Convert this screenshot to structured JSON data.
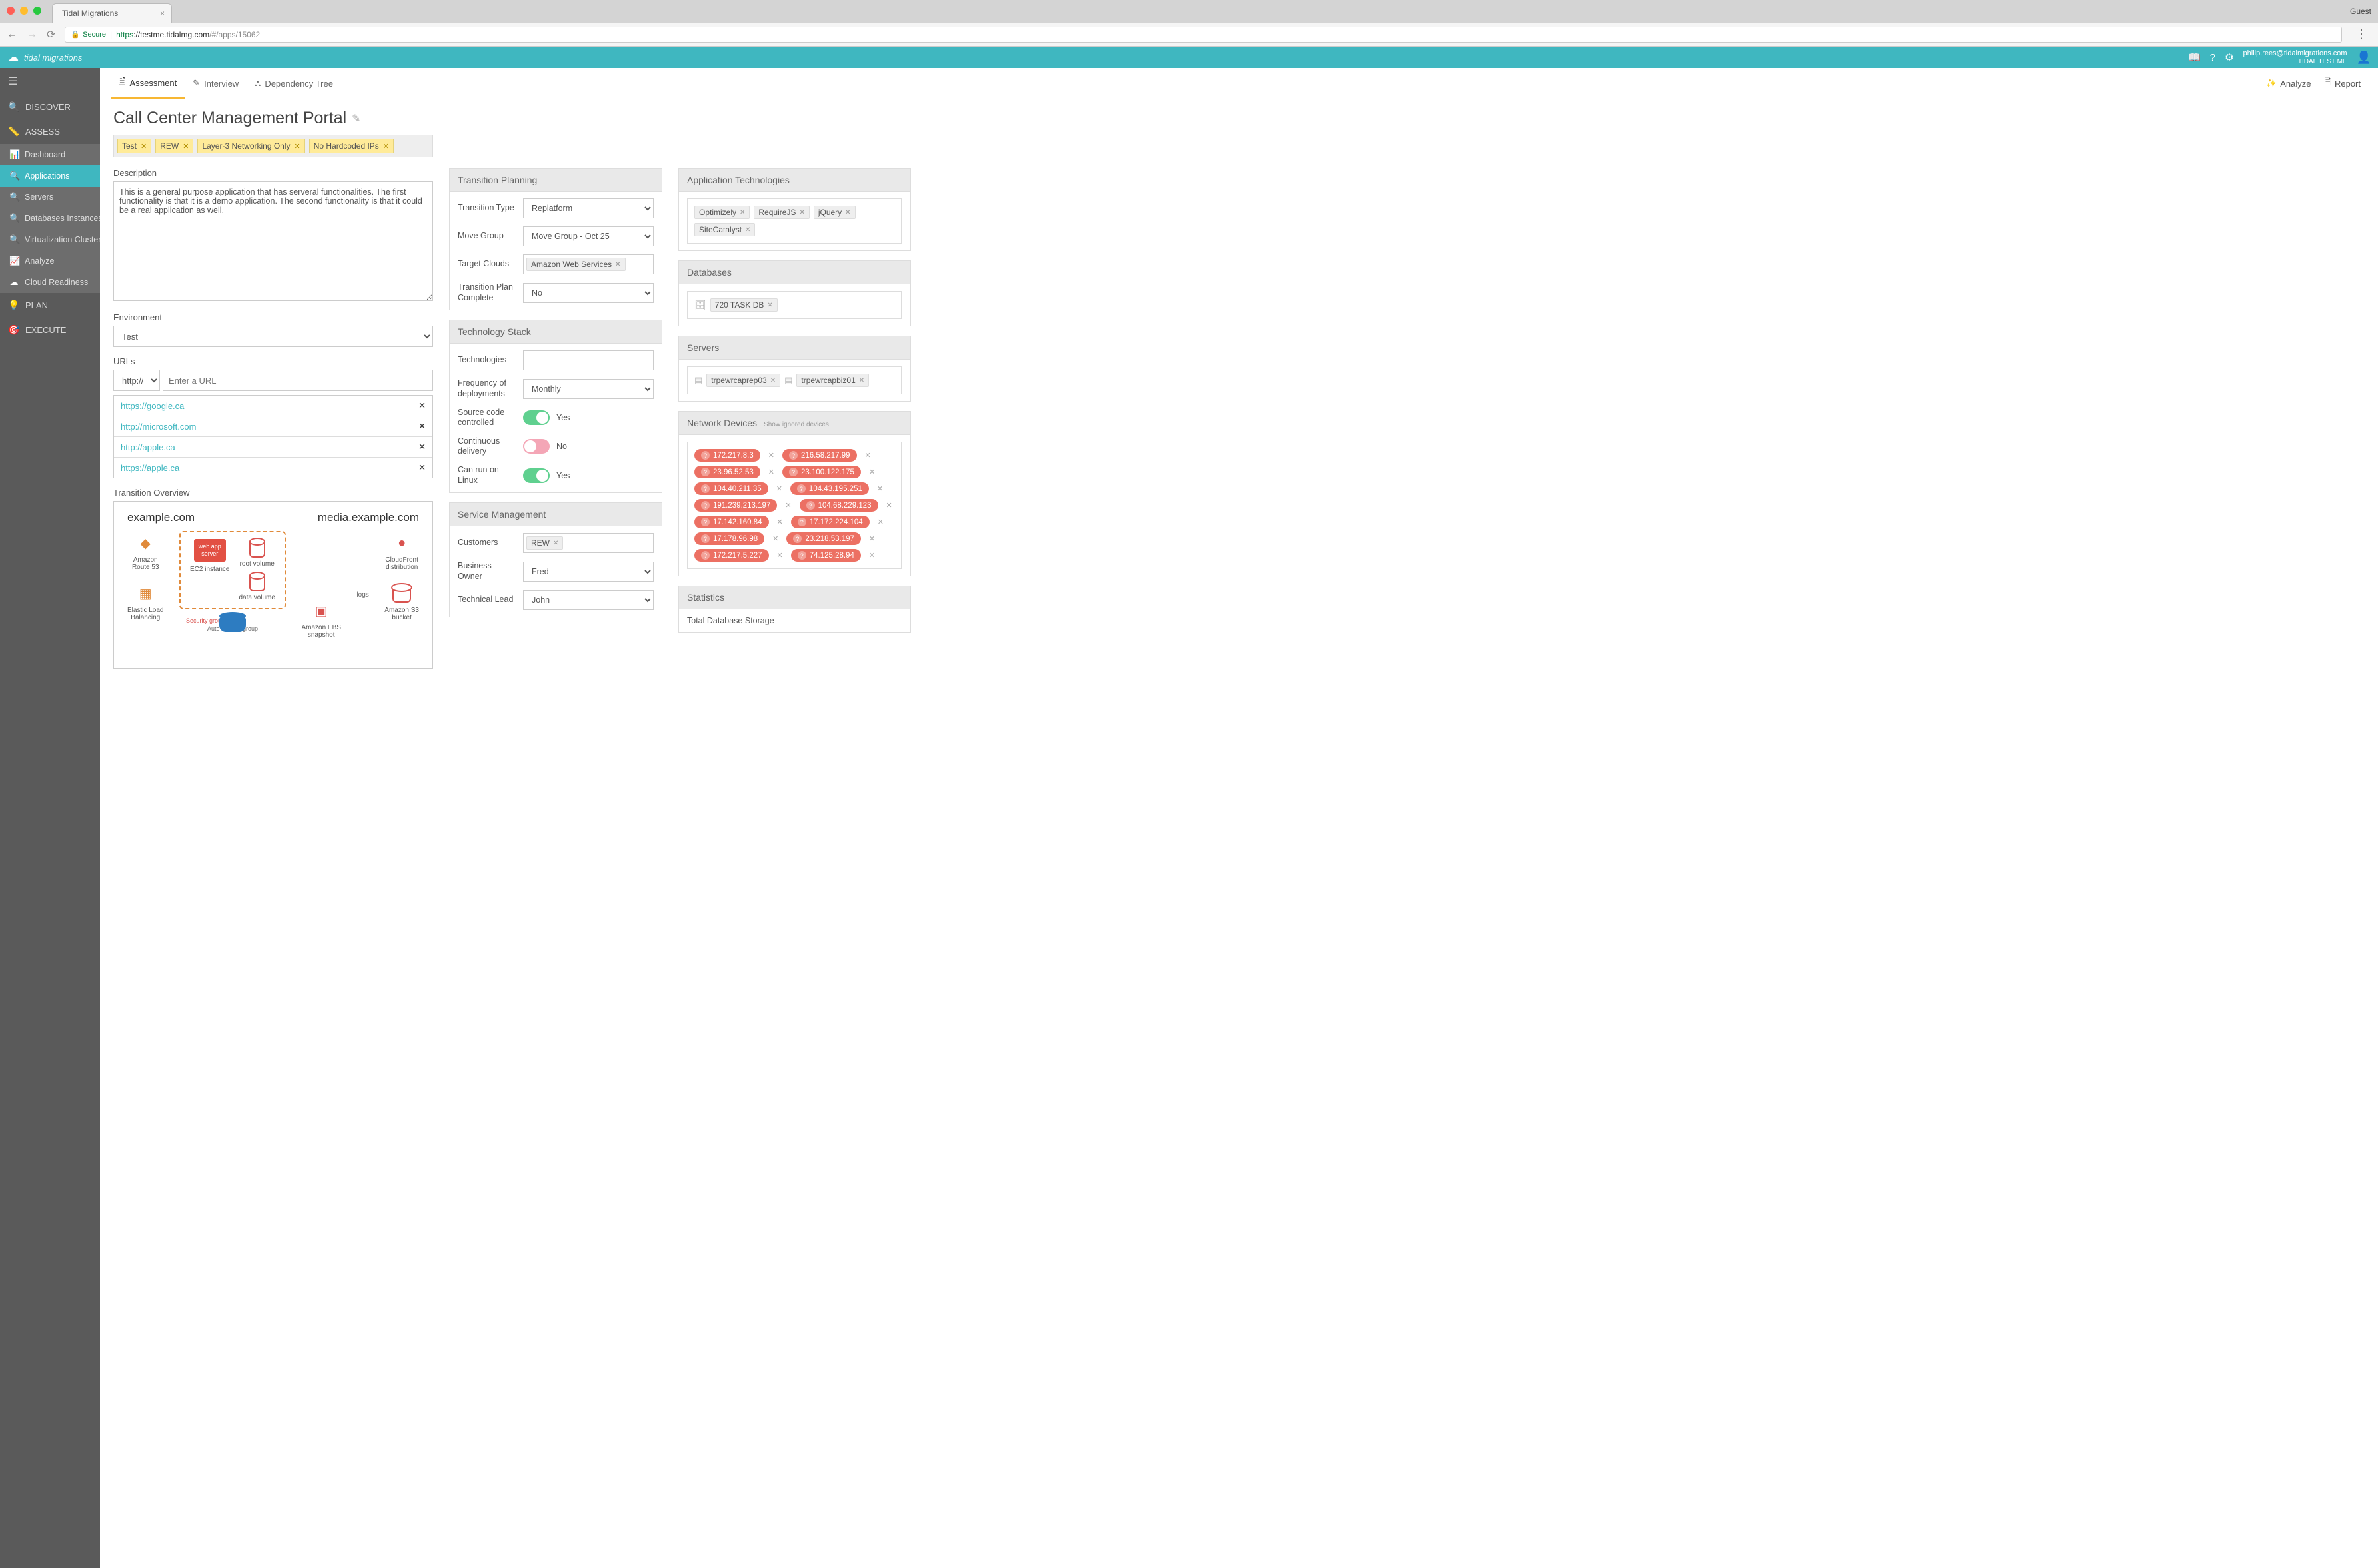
{
  "browser": {
    "tab_title": "Tidal Migrations",
    "guest": "Guest",
    "secure_label": "Secure",
    "url_scheme": "https",
    "url_host": "://testme.tidalmg.com",
    "url_path": "/#/apps/15062"
  },
  "topbar": {
    "logo": "tidal migrations",
    "user_email": "philip.rees@tidalmigrations.com",
    "user_org": "TIDAL TEST ME"
  },
  "sidebar": {
    "sections": {
      "discover": "DISCOVER",
      "assess": "ASSESS",
      "plan": "PLAN",
      "execute": "EXECUTE"
    },
    "assess_items": {
      "dashboard": "Dashboard",
      "applications": "Applications",
      "servers": "Servers",
      "db_instances": "Databases Instances",
      "virt_clusters": "Virtualization Clusters",
      "analyze": "Analyze",
      "cloud_readiness": "Cloud Readiness"
    }
  },
  "tabs": {
    "assessment": "Assessment",
    "interview": "Interview",
    "dependency_tree": "Dependency Tree",
    "analyze": "Analyze",
    "report": "Report"
  },
  "page": {
    "title": "Call Center Management Portal",
    "tags": [
      "Test",
      "REW",
      "Layer-3 Networking Only",
      "No Hardcoded IPs"
    ],
    "desc_label": "Description",
    "desc_value": "This is a general purpose application that has serveral functionalities. The first functionality is that it is a demo application. The second functionality is that it could be a real application as well.",
    "env_label": "Environment",
    "env_value": "Test",
    "urls_label": "URLs",
    "url_scheme": "http://",
    "url_placeholder": "Enter a URL",
    "urls": [
      "https://google.ca",
      "http://microsoft.com",
      "http://apple.ca",
      "https://apple.ca"
    ],
    "overview_label": "Transition Overview"
  },
  "diagram": {
    "domain1": "example.com",
    "domain2": "media.example.com",
    "route53": "Amazon\nRoute 53",
    "elb": "Elastic Load\nBalancing",
    "webapp": "web app server",
    "ec2": "EC2 instance",
    "secgroup": "Security group",
    "asg": "Auto Scaling group",
    "rootvol": "root volume",
    "datavol": "data volume",
    "ebs": "Amazon EBS\nsnapshot",
    "logs": "logs",
    "s3": "Amazon S3\nbucket",
    "cloudfront": "CloudFront\ndistribution"
  },
  "transition": {
    "title": "Transition Planning",
    "type_label": "Transition Type",
    "type_value": "Replatform",
    "move_label": "Move Group",
    "move_value": "Move Group - Oct 25",
    "clouds_label": "Target Clouds",
    "clouds": [
      "Amazon Web Services"
    ],
    "complete_label": "Transition Plan Complete",
    "complete_value": "No"
  },
  "techstack": {
    "title": "Technology Stack",
    "tech_label": "Technologies",
    "freq_label": "Frequency of deployments",
    "freq_value": "Monthly",
    "scc_label": "Source code controlled",
    "scc_value": "Yes",
    "cd_label": "Continuous delivery",
    "cd_value": "No",
    "linux_label": "Can run on Linux",
    "linux_value": "Yes"
  },
  "service": {
    "title": "Service Management",
    "customers_label": "Customers",
    "customers": [
      "REW"
    ],
    "owner_label": "Business Owner",
    "owner_value": "Fred",
    "lead_label": "Technical Lead",
    "lead_value": "John"
  },
  "apptech": {
    "title": "Application Technologies",
    "items": [
      "Optimizely",
      "RequireJS",
      "jQuery",
      "SiteCatalyst"
    ]
  },
  "databases": {
    "title": "Databases",
    "items": [
      "720 TASK DB"
    ]
  },
  "servers": {
    "title": "Servers",
    "items": [
      "trpewrcaprep03",
      "trpewrcapbiz01"
    ]
  },
  "netdev": {
    "title": "Network Devices",
    "show_ignored": "Show ignored devices",
    "rows": [
      [
        "172.217.8.3",
        "216.58.217.99"
      ],
      [
        "23.96.52.53",
        "23.100.122.175"
      ],
      [
        "104.40.211.35",
        "104.43.195.251"
      ],
      [
        "191.239.213.197",
        "104.68.229.123"
      ],
      [
        "17.142.160.84",
        "17.172.224.104"
      ],
      [
        "17.178.96.98",
        "23.218.53.197"
      ],
      [
        "172.217.5.227",
        "74.125.28.94"
      ]
    ]
  },
  "stats": {
    "title": "Statistics",
    "storage_label": "Total Database Storage"
  }
}
